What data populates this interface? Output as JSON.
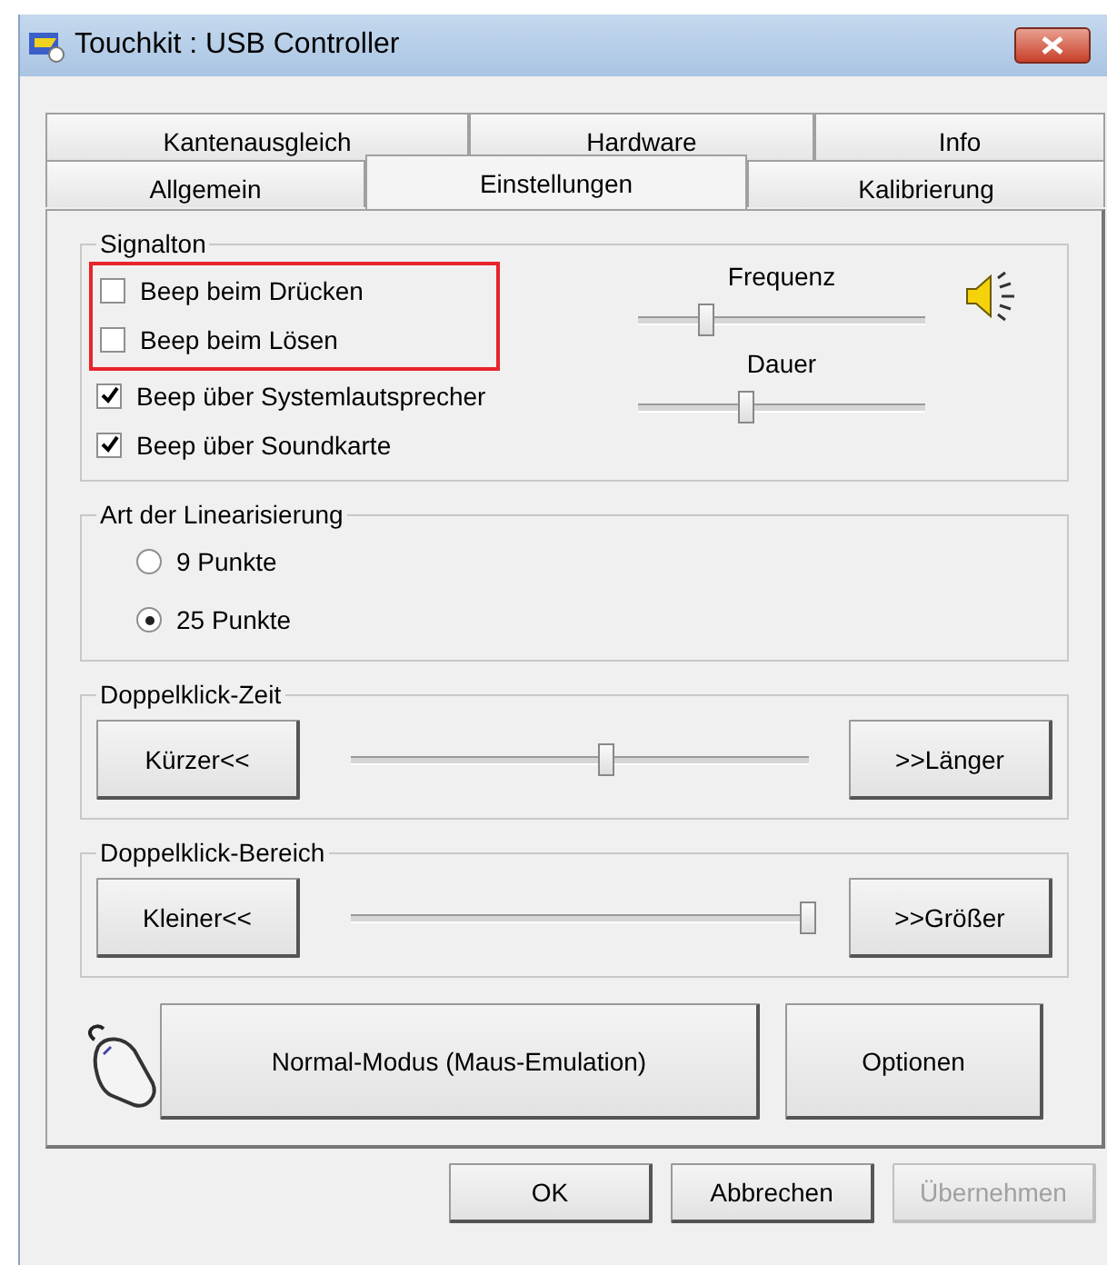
{
  "window": {
    "title": "Touchkit : USB Controller"
  },
  "tab_rows": [
    [
      {
        "label": "Kantenausgleich",
        "selected": false
      },
      {
        "label": "Hardware",
        "selected": false
      },
      {
        "label": "Info",
        "selected": false
      }
    ],
    [
      {
        "label": "Allgemein",
        "selected": false
      },
      {
        "label": "Einstellungen",
        "selected": true
      },
      {
        "label": "Kalibrierung",
        "selected": false
      }
    ]
  ],
  "signalton": {
    "title": "Signalton",
    "checkboxes": [
      {
        "label": "Beep beim Drücken",
        "checked": false,
        "highlighted": true
      },
      {
        "label": "Beep beim Lösen",
        "checked": false,
        "highlighted": true
      },
      {
        "label": "Beep über Systemlautsprecher",
        "checked": true,
        "highlighted": false
      },
      {
        "label": "Beep über Soundkarte",
        "checked": true,
        "highlighted": false
      }
    ],
    "sliders": [
      {
        "label": "Frequenz",
        "level": 0.24
      },
      {
        "label": "Dauer",
        "level": 0.38
      }
    ]
  },
  "linearisierung": {
    "title": "Art der Linearisierung",
    "options": [
      {
        "label": "9 Punkte",
        "selected": false
      },
      {
        "label": "25 Punkte",
        "selected": true
      }
    ]
  },
  "doppelklick_zeit": {
    "title": "Doppelklick-Zeit",
    "left_button": "Kürzer<<",
    "level": 0.56,
    "right_button": ">>Länger"
  },
  "doppelklick_bereich": {
    "title": "Doppelklick-Bereich",
    "left_button": "Kleiner<<",
    "level": 1.0,
    "right_button": ">>Größer"
  },
  "mode_button": "Normal-Modus (Maus-Emulation)",
  "options_button": "Optionen",
  "buttons": [
    {
      "label": "OK",
      "disabled": false
    },
    {
      "label": "Abbrechen",
      "disabled": false
    },
    {
      "label": "Übernehmen",
      "disabled": true
    }
  ]
}
